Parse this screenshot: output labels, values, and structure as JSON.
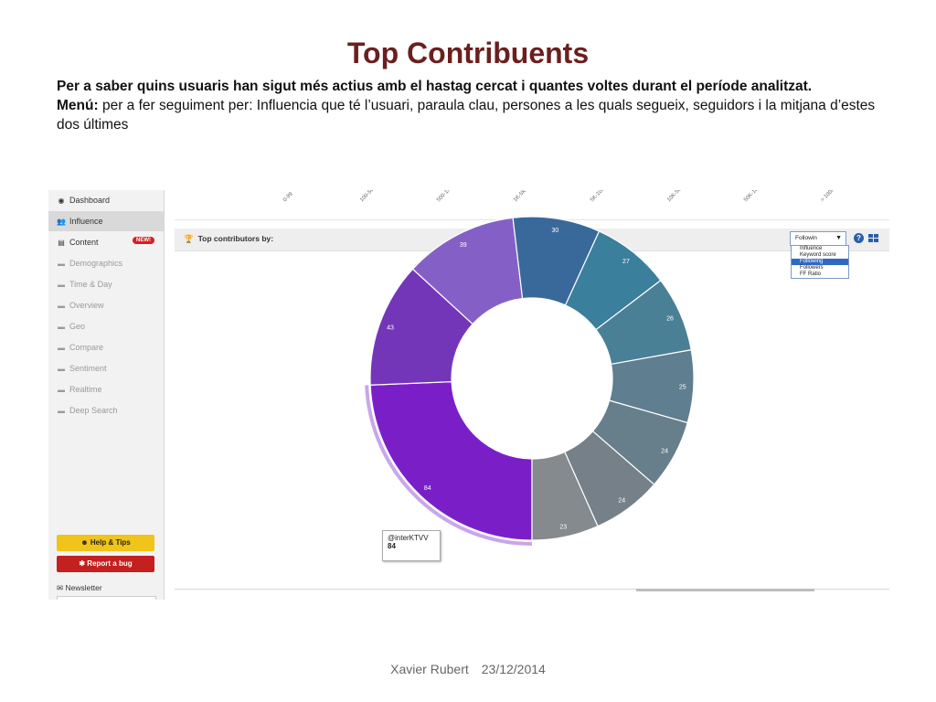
{
  "slide": {
    "title": "Top Contribuents",
    "line1": "Per a saber quins usuaris han sigut més actius amb el hastag cercat i quantes voltes durant el període analitzat.",
    "menu_label": "Menú:",
    "menu_text": " per a fer seguiment per: Influencia que té l’usuari, paraula clau, persones a les quals segueix, seguidors i la mitjana d’estes dos últimes",
    "footer_author": "Xavier Rubert",
    "footer_date": "23/12/2014"
  },
  "sidebar": {
    "items": [
      {
        "label": "Dashboard",
        "icon": "dashboard-icon",
        "glyph": "◉"
      },
      {
        "label": "Influence",
        "icon": "users-icon",
        "glyph": "👥"
      },
      {
        "label": "Content",
        "icon": "document-icon",
        "glyph": "▤",
        "badge": "NEW!"
      },
      {
        "label": "Demographics",
        "icon": "lock-icon",
        "glyph": "▬"
      },
      {
        "label": "Time & Day",
        "icon": "lock-icon",
        "glyph": "▬"
      },
      {
        "label": "Overview",
        "icon": "lock-icon",
        "glyph": "▬"
      },
      {
        "label": "Geo",
        "icon": "lock-icon",
        "glyph": "▬"
      },
      {
        "label": "Compare",
        "icon": "lock-icon",
        "glyph": "▬"
      },
      {
        "label": "Sentiment",
        "icon": "lock-icon",
        "glyph": "▬"
      },
      {
        "label": "Realtime",
        "icon": "lock-icon",
        "glyph": "▬"
      },
      {
        "label": "Deep Search",
        "icon": "lock-icon",
        "glyph": "▬"
      }
    ],
    "help_button": "Help & Tips",
    "bug_button": "Report a bug",
    "newsletter": "Newsletter"
  },
  "top_axis_ticks": [
    "0-99",
    "100-500",
    "500-1K",
    "1K-5K",
    "5K-10K",
    "10K-50K",
    "50K-100K",
    "> 100K"
  ],
  "panel": {
    "title": "Top contributors by:",
    "select_value": "Followin",
    "options": [
      "Influence",
      "Keyword score",
      "Following",
      "Followers",
      "FF Ratio"
    ],
    "selected_option": "Following"
  },
  "tooltip": {
    "name": "@interKTVV",
    "value": "84"
  },
  "chart_data": {
    "type": "pie",
    "values": [
      84,
      43,
      39,
      30,
      27,
      26,
      25,
      24,
      24,
      23
    ],
    "colors": [
      "#7a1fc8",
      "#7436b8",
      "#8460c6",
      "#39699a",
      "#3a7f9b",
      "#4a8096",
      "#5f7e90",
      "#667f8a",
      "#758088",
      "#848a8d"
    ],
    "labels_shown": [
      "84",
      "43",
      "39",
      "30",
      "27",
      "26",
      "25",
      "24",
      "24",
      "23"
    ]
  }
}
